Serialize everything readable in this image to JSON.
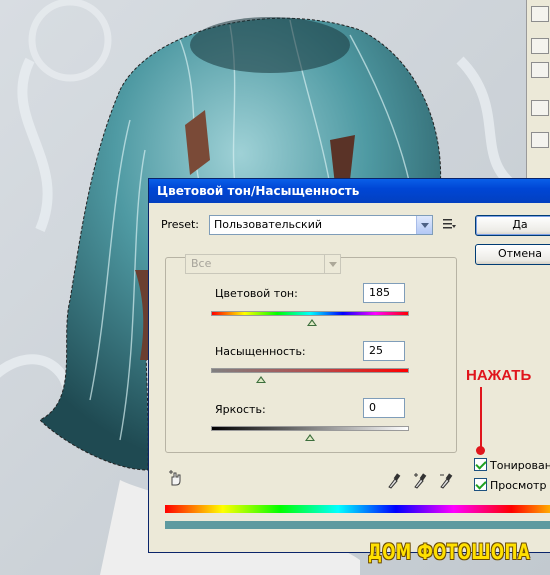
{
  "dialog": {
    "title": "Цветовой тон/Насыщенность",
    "preset_label": "Preset:",
    "preset_value": "Пользовательский",
    "channel_value": "Все",
    "ok_label": "Да",
    "cancel_label": "Отмена",
    "hue": {
      "label": "Цветовой тон:",
      "value": "185",
      "slider_fraction": 0.51
    },
    "saturation": {
      "label": "Насыщенность:",
      "value": "25",
      "slider_fraction": 0.25
    },
    "lightness": {
      "label": "Яркость:",
      "value": "0",
      "slider_fraction": 0.5
    },
    "colorize_label": "Тонирование",
    "preview_label": "Просмотр",
    "colorize_checked": true,
    "preview_checked": true
  },
  "annotation": {
    "text": "НАЖАТЬ",
    "color": "#e0151c"
  },
  "watermark": {
    "text": "ДОМ ФОТОШОПА"
  },
  "icons": [
    "preset-menu-icon",
    "hand-adjust-icon",
    "eyedropper-icon",
    "eyedropper-plus-icon",
    "eyedropper-minus-icon",
    "checkmark-icon"
  ]
}
